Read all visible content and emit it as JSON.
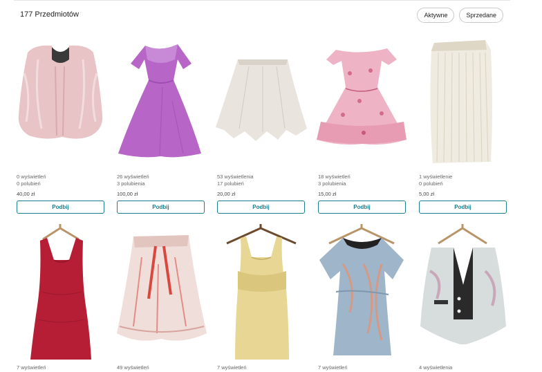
{
  "header": {
    "item_count": "177 Przedmiotów",
    "filter_active": "Aktywne",
    "filter_sold": "Sprzedane"
  },
  "items": [
    {
      "views": "0 wyświetleń",
      "likes": "0 polubień",
      "price": "40,00 zł",
      "action": "Podbij",
      "icon": "fur-vest-icon"
    },
    {
      "views": "26 wyświetleń",
      "likes": "3 polubienia",
      "price": "100,00 zł",
      "action": "Podbij",
      "icon": "purple-dress-icon"
    },
    {
      "views": "53 wyświetlenia",
      "likes": "17 polubień",
      "price": "20,00 zł",
      "action": "Podbij",
      "icon": "beige-skirt-icon"
    },
    {
      "views": "18 wyświetleń",
      "likes": "3 polubienia",
      "price": "15,00 zł",
      "action": "Podbij",
      "icon": "floral-dress-icon"
    },
    {
      "views": "1 wyświetlenie",
      "likes": "0 polubień",
      "price": "5,00 zł",
      "action": "Podbij",
      "icon": "pleated-skirt-icon"
    },
    {
      "views": "7 wyświetleń",
      "icon": "red-dress-icon"
    },
    {
      "views": "49 wyświetleń",
      "icon": "lace-skirt-icon"
    },
    {
      "views": "7 wyświetleń",
      "icon": "yellow-dress-icon"
    },
    {
      "views": "7 wyświetleń",
      "icon": "blouse-icon"
    },
    {
      "views": "4 wyświetlenia",
      "icon": "waistcoat-icon"
    }
  ]
}
